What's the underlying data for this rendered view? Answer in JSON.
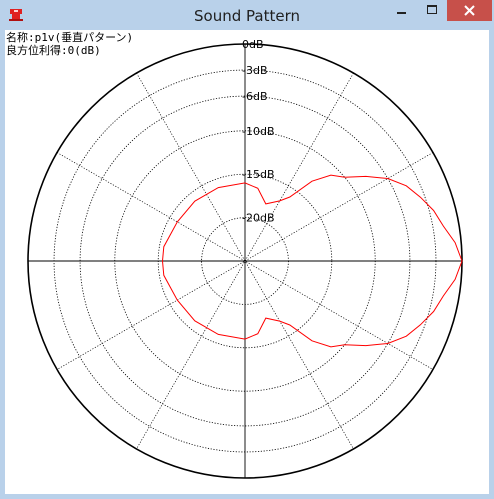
{
  "window": {
    "title": "Sound Pattern",
    "app_icon": "red-speaker-icon",
    "controls": [
      "minimize-icon",
      "maximize-icon",
      "close-icon"
    ],
    "close_color": "#c7504a",
    "frame_color": "#b9d1ea"
  },
  "info": {
    "name_line": "名称:p1v(垂直パターン)",
    "gain_line": "良方位利得:0(dB)"
  },
  "chart_data": {
    "type": "polar",
    "radial_unit": "dB",
    "ring_labels": [
      "0dB",
      "-3dB",
      "-6dB",
      "-10dB",
      "-15dB",
      "-20dB"
    ],
    "ring_levels_db": [
      0,
      -3,
      -6,
      -10,
      -15,
      -20
    ],
    "radial_lines_every_deg": 30,
    "curve_color": "#ff0000",
    "series": [
      {
        "angles_deg": [
          0,
          5,
          10,
          15,
          20,
          25,
          30,
          35,
          40,
          45,
          50,
          55,
          60,
          70,
          80,
          90,
          110,
          130,
          150,
          170,
          180,
          190,
          210,
          230,
          250,
          270,
          280,
          290,
          300,
          305,
          310,
          315,
          320,
          325,
          330,
          335,
          340,
          345,
          350,
          355
        ],
        "levels_db": [
          0,
          -0.7,
          -1.8,
          -2.5,
          -3.5,
          -4.5,
          -6,
          -8,
          -10,
          -11,
          -13,
          -16,
          -17,
          -18,
          -16.5,
          -16,
          -16,
          -16,
          -16,
          -15.5,
          -15.5,
          -15.5,
          -16,
          -16,
          -16,
          -16,
          -16.5,
          -18,
          -17,
          -16,
          -13,
          -11,
          -10,
          -8,
          -6,
          -4.5,
          -3.5,
          -2.5,
          -1.8,
          -0.7
        ]
      }
    ]
  }
}
